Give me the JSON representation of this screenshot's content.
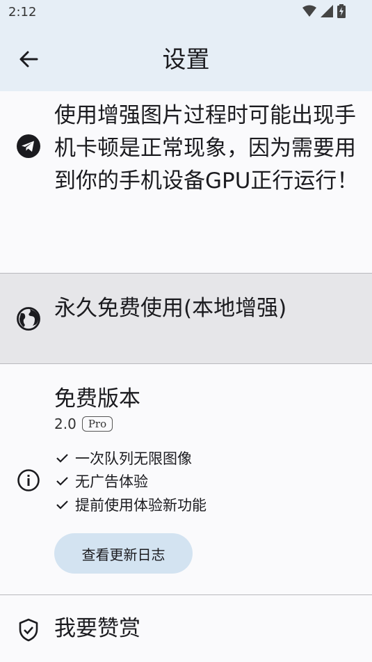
{
  "status_bar": {
    "time": "2:12",
    "icons": [
      "wifi-icon",
      "signal-icon",
      "battery-charging-icon"
    ]
  },
  "app_bar": {
    "title": "设置",
    "back_icon": "arrow-back-icon"
  },
  "notice": {
    "icon": "telegram-icon",
    "text": "使用增强图片过程时可能出现手机卡顿是正常现象，因为需要用到你的手机设备GPU正行运行！"
  },
  "free_forever": {
    "icon": "globe-icon",
    "label": "永久免费使用(本地增强)"
  },
  "version": {
    "icon": "info-icon",
    "title": "免费版本",
    "number": "2.0",
    "badge": "Pro",
    "features": [
      "一次队列无限图像",
      "无广告体验",
      "提前使用体验新功能"
    ],
    "changelog_button": "查看更新日志"
  },
  "donate": {
    "icon": "shield-check-icon",
    "label": "我要赞赏"
  },
  "colors": {
    "app_bar_bg": "#e6eef6",
    "highlight_row_bg": "#e6e6e9",
    "button_bg": "#d3e3f1"
  }
}
